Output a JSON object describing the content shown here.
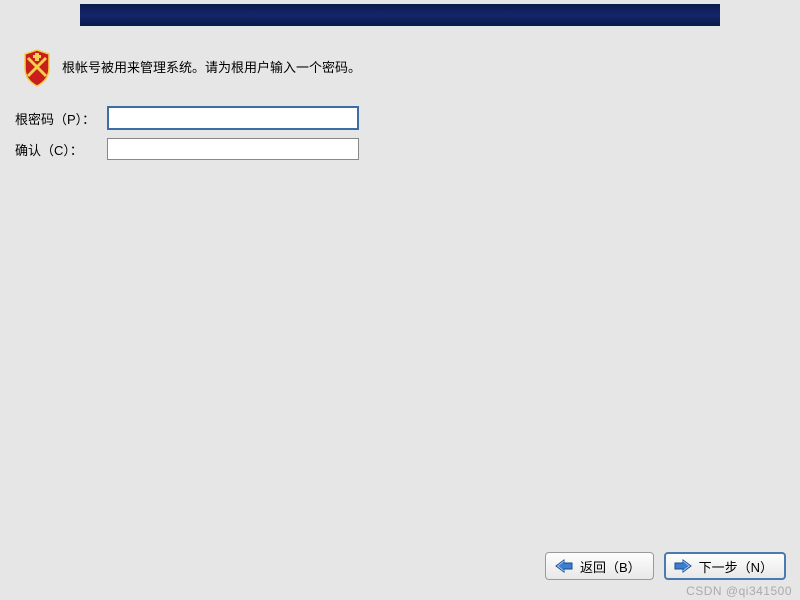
{
  "instruction": "根帐号被用来管理系统。请为根用户输入一个密码。",
  "form": {
    "password_label": "根密码（P）：",
    "confirm_label": "确认（C）：",
    "password_value": "",
    "confirm_value": ""
  },
  "buttons": {
    "back_label": "返回（B）",
    "next_label": "下一步（N）"
  },
  "watermark": "CSDN @qi341500"
}
